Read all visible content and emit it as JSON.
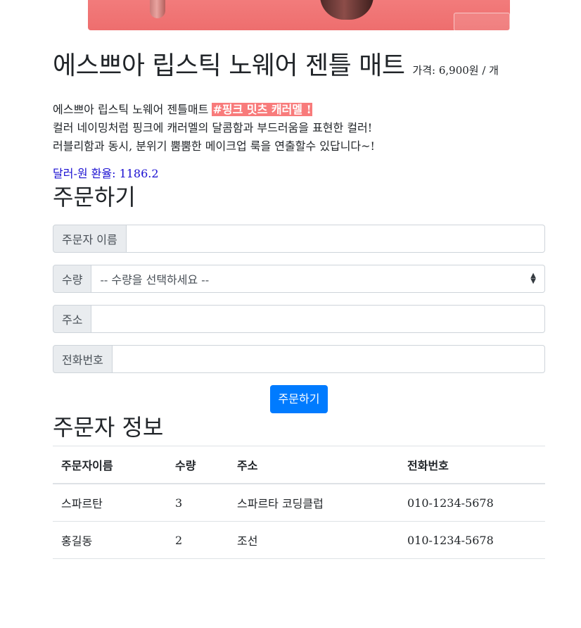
{
  "product": {
    "title": "에스쁘아 립스틱 노웨어 젠틀 매트",
    "price_text": "가격: 6,900원 / 개",
    "desc_line1_pre": "에스쁘아 립스틱 노웨어 젠틀매트 ",
    "desc_highlight": "#핑크 밋츠 캐러멜 !",
    "desc_line2": "컬러 네이밍처럼 핑크에 캐러멜의 달콤함과 부드러움을 표현한 컬러!",
    "desc_line3": "러블리함과 동시, 분위기 뿜뿜한 메이크업 룩을 연출할수 있답니다~!",
    "rate_text": "달러-원 환율: 1186.2"
  },
  "order": {
    "heading": "주문하기",
    "name_label": "주문자 이름",
    "name_value": "",
    "qty_label": "수량",
    "qty_selected": "-- 수량을 선택하세요 --",
    "address_label": "주소",
    "address_value": "",
    "phone_label": "전화번호",
    "phone_value": "",
    "submit_label": "주문하기"
  },
  "orders_table": {
    "heading": "주문자 정보",
    "columns": [
      "주문자이름",
      "수량",
      "주소",
      "전화번호"
    ],
    "rows": [
      [
        "스파르탄",
        "3",
        "스파르타 코딩클럽",
        "010-1234-5678"
      ],
      [
        "홍길동",
        "2",
        "조선",
        "010-1234-5678"
      ]
    ]
  },
  "colors": {
    "highlight": "#f87b7b",
    "rate": "#1a0fd1",
    "button": "#007bff"
  }
}
